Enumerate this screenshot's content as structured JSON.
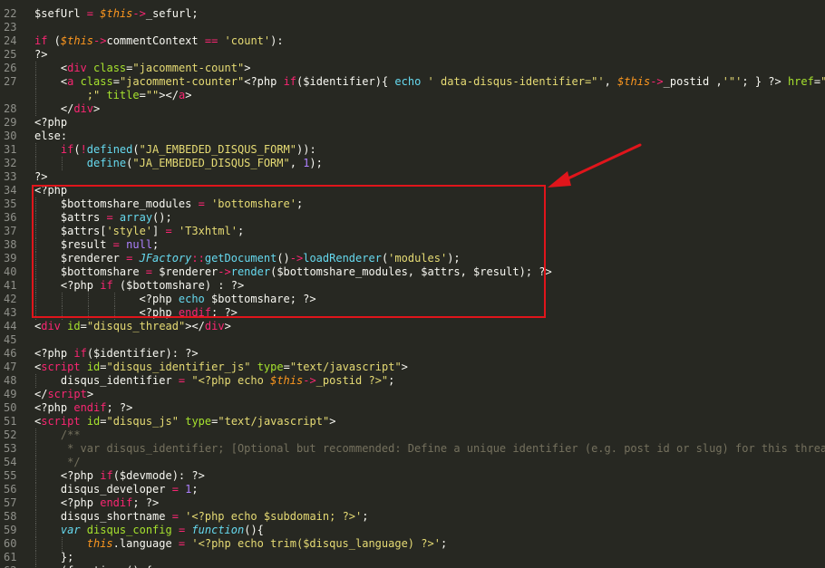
{
  "editor": {
    "colors": {
      "background": "#272822",
      "annotation": "#e0151b"
    },
    "lines": [
      {
        "num": "22",
        "indent": 0,
        "tokens": [
          [
            "$sefUrl ",
            "default"
          ],
          [
            "=",
            "operator"
          ],
          [
            " ",
            "default"
          ],
          [
            "$this",
            "this"
          ],
          [
            "->",
            "operator"
          ],
          [
            "_sefurl;",
            "default"
          ]
        ]
      },
      {
        "num": "23",
        "indent": 0,
        "tokens": []
      },
      {
        "num": "24",
        "indent": 0,
        "tokens": [
          [
            "if",
            "keyword"
          ],
          [
            " (",
            "default"
          ],
          [
            "$this",
            "this"
          ],
          [
            "->",
            "operator"
          ],
          [
            "commentContext ",
            "default"
          ],
          [
            "==",
            "operator"
          ],
          [
            " ",
            "default"
          ],
          [
            "'count'",
            "string"
          ],
          [
            "):",
            "default"
          ]
        ]
      },
      {
        "num": "25",
        "indent": 0,
        "tokens": [
          [
            "?>",
            "default"
          ]
        ]
      },
      {
        "num": "26",
        "indent": 1,
        "tokens": [
          [
            "<",
            "default"
          ],
          [
            "div",
            "tag"
          ],
          [
            " ",
            "default"
          ],
          [
            "class",
            "attr"
          ],
          [
            "=",
            "default"
          ],
          [
            "\"jacomment-count\"",
            "string"
          ],
          [
            ">",
            "default"
          ]
        ]
      },
      {
        "num": "27",
        "indent": 1,
        "tokens": [
          [
            "<",
            "default"
          ],
          [
            "a",
            "tag"
          ],
          [
            " ",
            "default"
          ],
          [
            "class",
            "attr"
          ],
          [
            "=",
            "default"
          ],
          [
            "\"jacomment-counter\"",
            "string"
          ],
          [
            "<?php ",
            "default"
          ],
          [
            "if",
            "keyword"
          ],
          [
            "($identifier){ ",
            "default"
          ],
          [
            "echo",
            "func"
          ],
          [
            " ",
            "default"
          ],
          [
            "' data-disqus-identifier=\"'",
            "string"
          ],
          [
            ", ",
            "default"
          ],
          [
            "$this",
            "this"
          ],
          [
            "->",
            "operator"
          ],
          [
            "_postid ,",
            "default"
          ],
          [
            "'\"'",
            "string"
          ],
          [
            "; } ?> ",
            "default"
          ],
          [
            "href",
            "attr"
          ],
          [
            "=",
            "default"
          ],
          [
            "\"<?ph",
            "string"
          ]
        ]
      },
      {
        "num": "",
        "indent": 1,
        "tokens": [
          [
            "    ;\" ",
            "string"
          ],
          [
            "title",
            "attr"
          ],
          [
            "=",
            "default"
          ],
          [
            "\"\"",
            "string"
          ],
          [
            "></",
            "default"
          ],
          [
            "a",
            "tag"
          ],
          [
            ">",
            "default"
          ]
        ]
      },
      {
        "num": "28",
        "indent": 1,
        "tokens": [
          [
            "</",
            "default"
          ],
          [
            "div",
            "tag"
          ],
          [
            ">",
            "default"
          ]
        ]
      },
      {
        "num": "29",
        "indent": 0,
        "tokens": [
          [
            "<?php",
            "default"
          ]
        ]
      },
      {
        "num": "30",
        "indent": 0,
        "tokens": [
          [
            "else:",
            "default"
          ]
        ]
      },
      {
        "num": "31",
        "indent": 1,
        "tokens": [
          [
            "if",
            "keyword"
          ],
          [
            "(",
            "default"
          ],
          [
            "!",
            "operator"
          ],
          [
            "defined",
            "func"
          ],
          [
            "(",
            "default"
          ],
          [
            "\"JA_EMBEDED_DISQUS_FORM\"",
            "string"
          ],
          [
            ")):",
            "default"
          ]
        ]
      },
      {
        "num": "32",
        "indent": 2,
        "tokens": [
          [
            "define",
            "func"
          ],
          [
            "(",
            "default"
          ],
          [
            "\"JA_EMBEDED_DISQUS_FORM\"",
            "string"
          ],
          [
            ", ",
            "default"
          ],
          [
            "1",
            "number"
          ],
          [
            ");",
            "default"
          ]
        ]
      },
      {
        "num": "33",
        "indent": 0,
        "tokens": [
          [
            "?>",
            "default"
          ]
        ]
      },
      {
        "num": "34",
        "indent": 0,
        "tokens": [
          [
            "<?php",
            "default"
          ]
        ]
      },
      {
        "num": "35",
        "indent": 1,
        "tokens": [
          [
            "$bottomshare_modules ",
            "default"
          ],
          [
            "=",
            "operator"
          ],
          [
            " ",
            "default"
          ],
          [
            "'bottomshare'",
            "string"
          ],
          [
            ";",
            "default"
          ]
        ]
      },
      {
        "num": "36",
        "indent": 1,
        "tokens": [
          [
            "$attrs ",
            "default"
          ],
          [
            "=",
            "operator"
          ],
          [
            " ",
            "default"
          ],
          [
            "array",
            "func"
          ],
          [
            "();",
            "default"
          ]
        ]
      },
      {
        "num": "37",
        "indent": 1,
        "tokens": [
          [
            "$attrs[",
            "default"
          ],
          [
            "'style'",
            "string"
          ],
          [
            "] ",
            "default"
          ],
          [
            "=",
            "operator"
          ],
          [
            " ",
            "default"
          ],
          [
            "'T3xhtml'",
            "string"
          ],
          [
            ";",
            "default"
          ]
        ]
      },
      {
        "num": "38",
        "indent": 1,
        "tokens": [
          [
            "$result ",
            "default"
          ],
          [
            "=",
            "operator"
          ],
          [
            " ",
            "default"
          ],
          [
            "null",
            "constant"
          ],
          [
            ";",
            "default"
          ]
        ]
      },
      {
        "num": "39",
        "indent": 1,
        "tokens": [
          [
            "$renderer ",
            "default"
          ],
          [
            "=",
            "operator"
          ],
          [
            " ",
            "default"
          ],
          [
            "JFactory",
            "class"
          ],
          [
            "::",
            "operator"
          ],
          [
            "getDocument",
            "func"
          ],
          [
            "()",
            "default"
          ],
          [
            "->",
            "operator"
          ],
          [
            "loadRenderer",
            "func"
          ],
          [
            "(",
            "default"
          ],
          [
            "'modules'",
            "string"
          ],
          [
            ");",
            "default"
          ]
        ]
      },
      {
        "num": "40",
        "indent": 1,
        "tokens": [
          [
            "$bottomshare ",
            "default"
          ],
          [
            "=",
            "operator"
          ],
          [
            " $renderer",
            "default"
          ],
          [
            "->",
            "operator"
          ],
          [
            "render",
            "func"
          ],
          [
            "($bottomshare_modules, $attrs, $result); ?>",
            "default"
          ]
        ]
      },
      {
        "num": "41",
        "indent": 1,
        "tokens": [
          [
            "<?php ",
            "default"
          ],
          [
            "if",
            "keyword"
          ],
          [
            " ($bottomshare) : ?>",
            "default"
          ]
        ]
      },
      {
        "num": "42",
        "indent": 4,
        "tokens": [
          [
            "<?php ",
            "default"
          ],
          [
            "echo",
            "func"
          ],
          [
            " $bottomshare; ?>",
            "default"
          ]
        ]
      },
      {
        "num": "43",
        "indent": 4,
        "tokens": [
          [
            "<?php ",
            "default"
          ],
          [
            "endif",
            "keyword"
          ],
          [
            "; ?>",
            "default"
          ]
        ]
      },
      {
        "num": "44",
        "indent": 0,
        "tokens": [
          [
            "<",
            "default"
          ],
          [
            "div",
            "tag"
          ],
          [
            " ",
            "default"
          ],
          [
            "id",
            "attr"
          ],
          [
            "=",
            "default"
          ],
          [
            "\"disqus_thread\"",
            "string"
          ],
          [
            "></",
            "default"
          ],
          [
            "div",
            "tag"
          ],
          [
            ">",
            "default"
          ]
        ]
      },
      {
        "num": "45",
        "indent": 0,
        "tokens": []
      },
      {
        "num": "46",
        "indent": 0,
        "tokens": [
          [
            "<?php ",
            "default"
          ],
          [
            "if",
            "keyword"
          ],
          [
            "($identifier): ?>",
            "default"
          ]
        ]
      },
      {
        "num": "47",
        "indent": 0,
        "tokens": [
          [
            "<",
            "default"
          ],
          [
            "script",
            "tag"
          ],
          [
            " ",
            "default"
          ],
          [
            "id",
            "attr"
          ],
          [
            "=",
            "default"
          ],
          [
            "\"disqus_identifier_js\"",
            "string"
          ],
          [
            " ",
            "default"
          ],
          [
            "type",
            "attr"
          ],
          [
            "=",
            "default"
          ],
          [
            "\"text/javascript\"",
            "string"
          ],
          [
            ">",
            "default"
          ]
        ]
      },
      {
        "num": "48",
        "indent": 1,
        "tokens": [
          [
            "disqus_identifier ",
            "default"
          ],
          [
            "=",
            "operator"
          ],
          [
            " ",
            "default"
          ],
          [
            "\"<?php echo ",
            "string"
          ],
          [
            "$this",
            "this"
          ],
          [
            "->",
            "operator"
          ],
          [
            "_postid ?>\"",
            "string"
          ],
          [
            ";",
            "default"
          ]
        ]
      },
      {
        "num": "49",
        "indent": 0,
        "tokens": [
          [
            "</",
            "default"
          ],
          [
            "script",
            "tag"
          ],
          [
            ">",
            "default"
          ]
        ]
      },
      {
        "num": "50",
        "indent": 0,
        "tokens": [
          [
            "<?php ",
            "default"
          ],
          [
            "endif",
            "keyword"
          ],
          [
            "; ?>",
            "default"
          ]
        ]
      },
      {
        "num": "51",
        "indent": 0,
        "tokens": [
          [
            "<",
            "default"
          ],
          [
            "script",
            "tag"
          ],
          [
            " ",
            "default"
          ],
          [
            "id",
            "attr"
          ],
          [
            "=",
            "default"
          ],
          [
            "\"disqus_js\"",
            "string"
          ],
          [
            " ",
            "default"
          ],
          [
            "type",
            "attr"
          ],
          [
            "=",
            "default"
          ],
          [
            "\"text/javascript\"",
            "string"
          ],
          [
            ">",
            "default"
          ]
        ]
      },
      {
        "num": "52",
        "indent": 1,
        "tokens": [
          [
            "/**",
            "comment"
          ]
        ]
      },
      {
        "num": "53",
        "indent": 1,
        "tokens": [
          [
            " * var disqus_identifier; [Optional but recommended: Define a unique identifier (e.g. post id or slug) for this thread]",
            "comment"
          ]
        ]
      },
      {
        "num": "54",
        "indent": 1,
        "tokens": [
          [
            " */",
            "comment"
          ]
        ]
      },
      {
        "num": "55",
        "indent": 1,
        "tokens": [
          [
            "<?php ",
            "default"
          ],
          [
            "if",
            "keyword"
          ],
          [
            "($devmode): ?>",
            "default"
          ]
        ]
      },
      {
        "num": "56",
        "indent": 1,
        "tokens": [
          [
            "disqus_developer ",
            "default"
          ],
          [
            "=",
            "operator"
          ],
          [
            " ",
            "default"
          ],
          [
            "1",
            "number"
          ],
          [
            ";",
            "default"
          ]
        ]
      },
      {
        "num": "57",
        "indent": 1,
        "tokens": [
          [
            "<?php ",
            "default"
          ],
          [
            "endif",
            "keyword"
          ],
          [
            "; ?>",
            "default"
          ]
        ]
      },
      {
        "num": "58",
        "indent": 1,
        "tokens": [
          [
            "disqus_shortname ",
            "default"
          ],
          [
            "=",
            "operator"
          ],
          [
            " ",
            "default"
          ],
          [
            "'<?php echo $subdomain; ?>'",
            "string"
          ],
          [
            ";",
            "default"
          ]
        ]
      },
      {
        "num": "59",
        "indent": 1,
        "tokens": [
          [
            "var",
            "class"
          ],
          [
            " ",
            "default"
          ],
          [
            "disqus_config",
            "attr"
          ],
          [
            " ",
            "default"
          ],
          [
            "=",
            "operator"
          ],
          [
            " ",
            "default"
          ],
          [
            "function",
            "class"
          ],
          [
            "(){",
            "default"
          ]
        ]
      },
      {
        "num": "60",
        "indent": 2,
        "tokens": [
          [
            "this",
            "this"
          ],
          [
            ".",
            "default"
          ],
          [
            "language ",
            "default"
          ],
          [
            "=",
            "operator"
          ],
          [
            " ",
            "default"
          ],
          [
            "'<?php echo trim($disqus_language) ?>'",
            "string"
          ],
          [
            ";",
            "default"
          ]
        ]
      },
      {
        "num": "61",
        "indent": 1,
        "tokens": [
          [
            "};",
            "default"
          ]
        ]
      },
      {
        "num": "62",
        "indent": 1,
        "tokens": [
          [
            "(function () {",
            "default"
          ]
        ]
      }
    ]
  }
}
